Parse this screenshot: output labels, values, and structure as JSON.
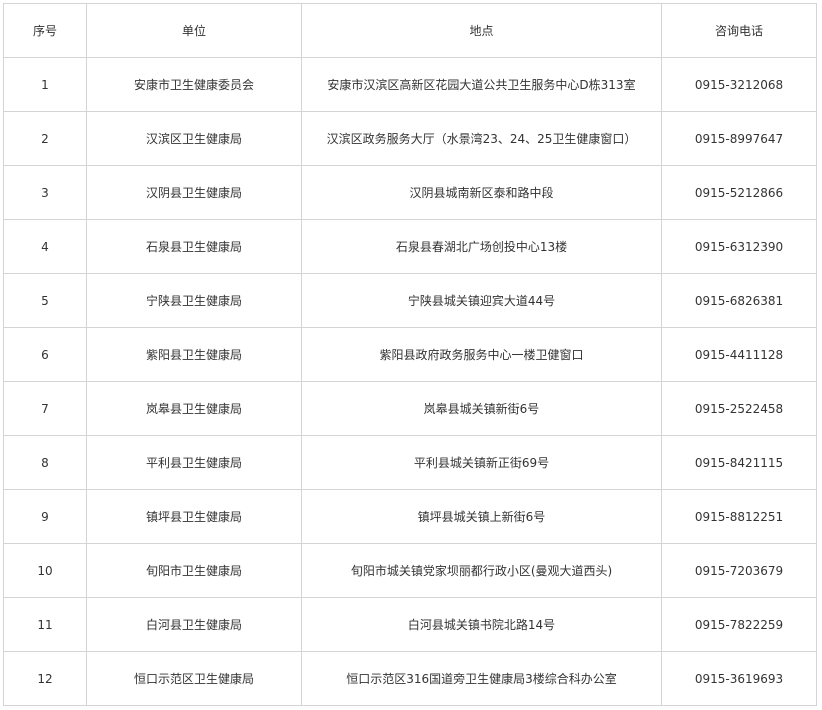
{
  "table": {
    "headers": [
      "序号",
      "单位",
      "地点",
      "咨询电话"
    ],
    "rows": [
      [
        "1",
        "安康市卫生健康委员会",
        "安康市汉滨区高新区花园大道公共卫生服务中心D栋313室",
        "0915-3212068"
      ],
      [
        "2",
        "汉滨区卫生健康局",
        "汉滨区政务服务大厅（水景湾23、24、25卫生健康窗口）",
        "0915-8997647"
      ],
      [
        "3",
        "汉阴县卫生健康局",
        "汉阴县城南新区泰和路中段",
        "0915-5212866"
      ],
      [
        "4",
        "石泉县卫生健康局",
        "石泉县春湖北广场创投中心13楼",
        "0915-6312390"
      ],
      [
        "5",
        "宁陕县卫生健康局",
        "宁陕县城关镇迎宾大道44号",
        "0915-6826381"
      ],
      [
        "6",
        "紫阳县卫生健康局",
        "紫阳县政府政务服务中心一楼卫健窗口",
        "0915-4411128"
      ],
      [
        "7",
        "岚皋县卫生健康局",
        "岚皋县城关镇新街6号",
        "0915-2522458"
      ],
      [
        "8",
        "平利县卫生健康局",
        "平利县城关镇新正街69号",
        "0915-8421115"
      ],
      [
        "9",
        "镇坪县卫生健康局",
        "镇坪县城关镇上新街6号",
        "0915-8812251"
      ],
      [
        "10",
        "旬阳市卫生健康局",
        "旬阳市城关镇党家坝丽都行政小区(曼观大道西头)",
        "0915-7203679"
      ],
      [
        "11",
        "白河县卫生健康局",
        "白河县城关镇书院北路14号",
        "0915-7822259"
      ],
      [
        "12",
        "恒口示范区卫生健康局",
        "恒口示范区316国道旁卫生健康局3楼综合科办公室",
        "0915-3619693"
      ]
    ]
  }
}
